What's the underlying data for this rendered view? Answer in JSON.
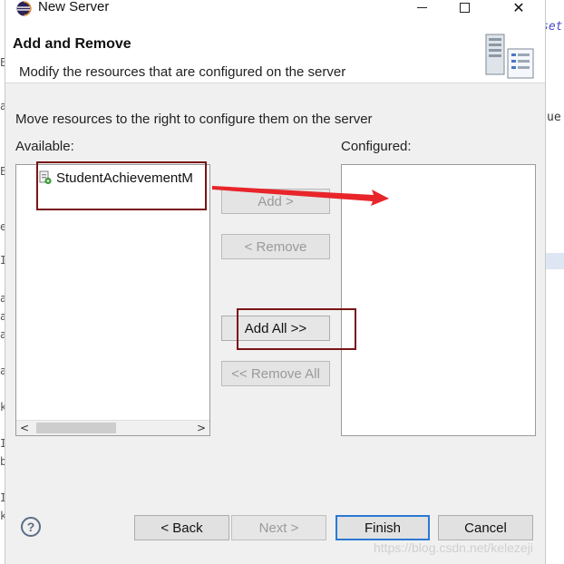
{
  "background": {
    "right_snippets": [
      "set",
      "ue"
    ],
    "left_chars": [
      "E",
      "a",
      "E",
      "e",
      "I",
      "a",
      "a",
      "a",
      "a",
      "k",
      "I",
      "b",
      "I",
      "k"
    ]
  },
  "dialog": {
    "title": "New Server",
    "app_icon": "eclipse-icon",
    "window_controls": {
      "minimize": "minimize",
      "maximize": "maximize",
      "close": "✕"
    },
    "banner": {
      "title": "Add and Remove",
      "description": "Modify the resources that are configured on the server",
      "icon": "server-wizard-icon"
    },
    "instruction": "Move resources to the right to configure them on the server",
    "available": {
      "label": "Available:",
      "items": [
        {
          "label": "StudentAchievementM",
          "icon": "web-module-icon"
        }
      ],
      "scroll_left": "<",
      "scroll_right": ">"
    },
    "configured": {
      "label": "Configured:",
      "items": []
    },
    "buttons": {
      "add": "Add >",
      "remove": "< Remove",
      "add_all": "Add All >>",
      "remove_all": "<< Remove All"
    },
    "footer": {
      "help": "?",
      "back": "< Back",
      "next": "Next >",
      "finish": "Finish",
      "cancel": "Cancel"
    },
    "watermark": "https://blog.csdn.net/kelezeji"
  },
  "colors": {
    "annotation": "#7a1515",
    "arrow": "#e8252a",
    "default_button_border": "#2b78d4"
  }
}
